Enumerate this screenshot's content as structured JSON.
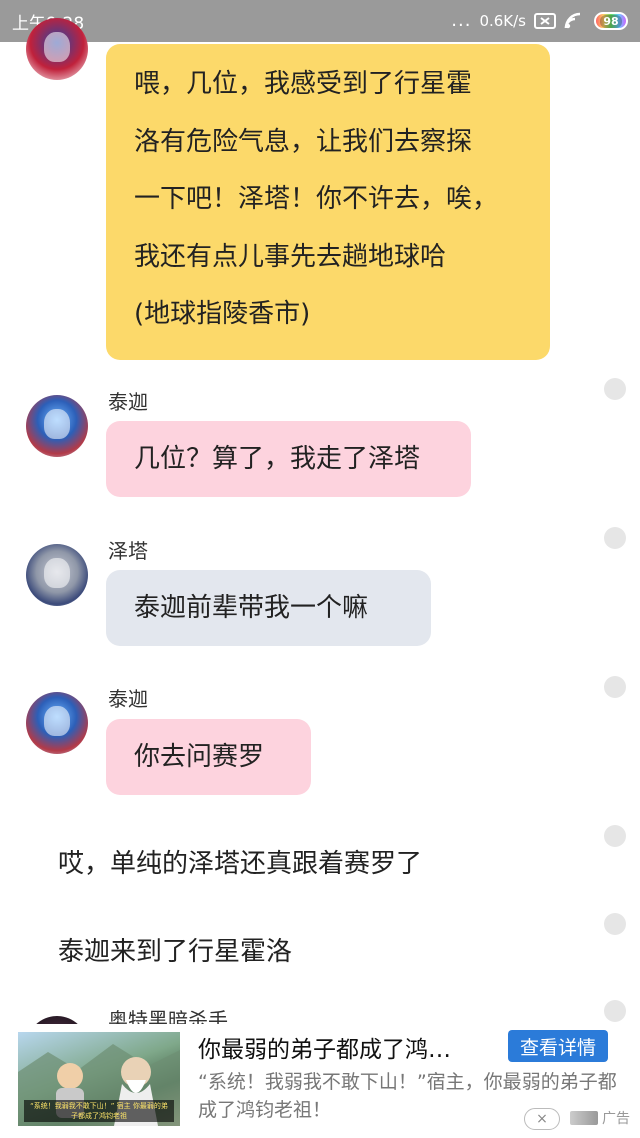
{
  "status_bar": {
    "time": "上午9:28",
    "dots": "...",
    "net_speed": "0.6K/s",
    "battery": "98"
  },
  "chat": {
    "messages": [
      {
        "type": "bubble",
        "speaker": "",
        "avatar_icon": "ultraman-avatar",
        "color": "#fcd96a",
        "lines": [
          "喂，几位，我感受到了行星霍",
          "洛有危险气息，让我们去察探",
          "一下吧！泽塔！你不许去，唉，",
          "我还有点儿事先去趟地球哈",
          "(地球指陵香市)"
        ]
      },
      {
        "type": "bubble",
        "speaker": "泰迦",
        "avatar_icon": "taiga-avatar",
        "color": "#fdd3de",
        "text": "几位？算了，我走了泽塔"
      },
      {
        "type": "bubble",
        "speaker": "泽塔",
        "avatar_icon": "zeta-avatar",
        "color": "#e3e7ee",
        "text": "泰迦前辈带我一个嘛"
      },
      {
        "type": "bubble",
        "speaker": "泰迦",
        "avatar_icon": "taiga-avatar",
        "color": "#fdd3de",
        "text": "你去问赛罗"
      },
      {
        "type": "narration",
        "text": "哎，单纯的泽塔还真跟着赛罗了"
      },
      {
        "type": "narration",
        "text": "泰迦来到了行星霍洛"
      },
      {
        "type": "speaker-only",
        "speaker": "奥特黑暗杀手",
        "avatar_icon": "dark-killer-avatar"
      }
    ]
  },
  "ad": {
    "title": "你最弱的弟子都成了鸿…",
    "button": "查看详情",
    "description": "“系统！我弱我不敢下山！”宿主，你最弱的弟子都成了鸿钧老祖！",
    "image_caption": "“系统！我弱我不敢下山！” 宿主 你最弱的弟子都成了鸿钧老祖",
    "close": "×",
    "label": "广告"
  }
}
